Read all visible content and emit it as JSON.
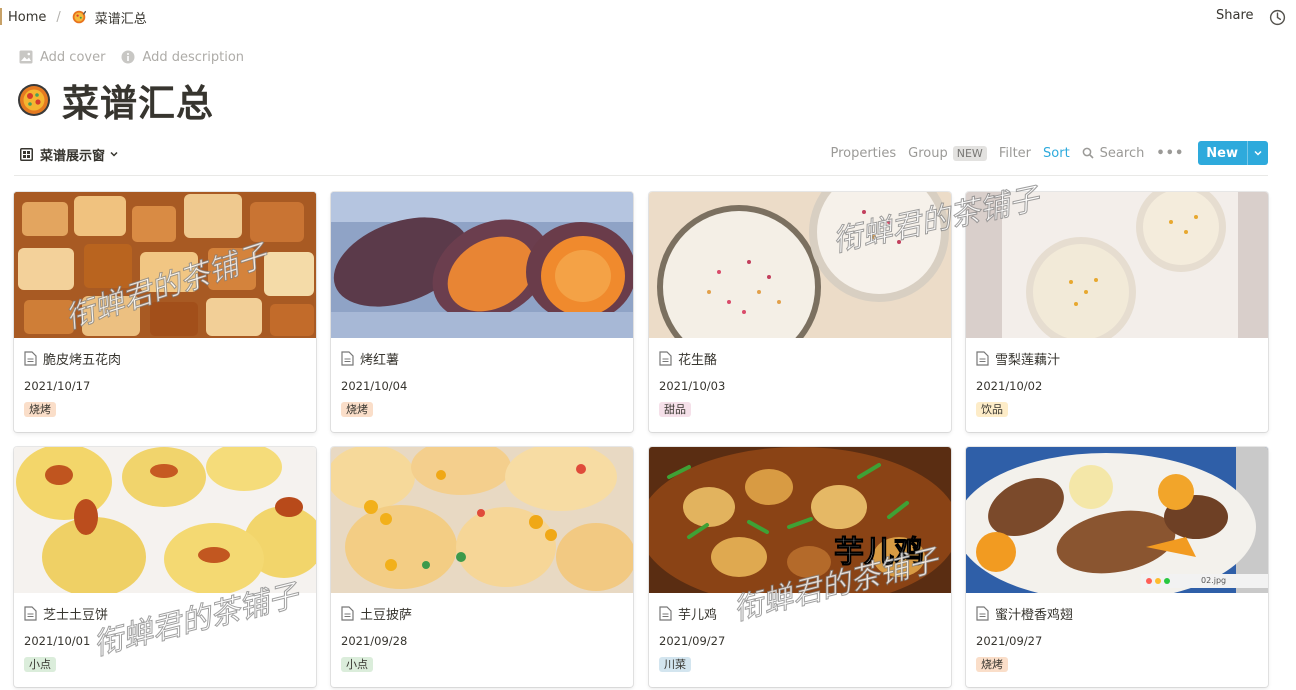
{
  "breadcrumb": {
    "home": "Home",
    "separator": "/",
    "current": "菜谱汇总"
  },
  "topbar": {
    "share_label": "Share"
  },
  "header": {
    "add_cover": "Add cover",
    "add_description": "Add description",
    "title": "菜谱汇总"
  },
  "view": {
    "name": "菜谱展示窗",
    "properties": "Properties",
    "group": "Group",
    "group_badge": "NEW",
    "filter": "Filter",
    "sort": "Sort",
    "search": "Search",
    "more": "•••",
    "new_button": "New"
  },
  "colors": {
    "accent_blue": "#2eaadc",
    "tag_bbq": "#fadec9",
    "tag_dessert": "#f5e0e9",
    "tag_drink": "#fdecc8",
    "tag_snack": "#dbeddb",
    "tag_sichuan": "#d3e5ef"
  },
  "watermark_text": "衔蝉君的茶铺子",
  "cover_caption": "芋儿鸡",
  "image_filename": "02.jpg",
  "cards": [
    {
      "title": "脆皮烤五花肉",
      "date": "2021/10/17",
      "tag": "烧烤"
    },
    {
      "title": "烤红薯",
      "date": "2021/10/04",
      "tag": "烧烤"
    },
    {
      "title": "花生酪",
      "date": "2021/10/03",
      "tag": "甜品"
    },
    {
      "title": "雪梨莲藕汁",
      "date": "2021/10/02",
      "tag": "饮品"
    },
    {
      "title": "芝士土豆饼",
      "date": "2021/10/01",
      "tag": "小点"
    },
    {
      "title": "土豆披萨",
      "date": "2021/09/28",
      "tag": "小点"
    },
    {
      "title": "芋儿鸡",
      "date": "2021/09/27",
      "tag": "川菜"
    },
    {
      "title": "蜜汁橙香鸡翅",
      "date": "2021/09/27",
      "tag": "烧烤"
    }
  ]
}
